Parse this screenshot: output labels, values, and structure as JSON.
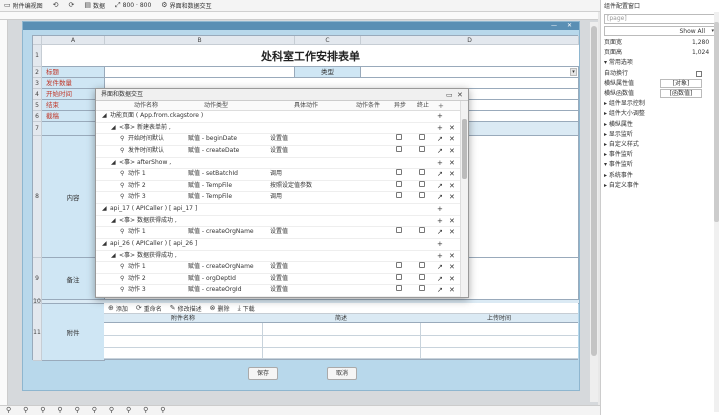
{
  "toolbar": {
    "items": [
      "附件编视图",
      "⟲",
      "⟳",
      "数据",
      "800 · 800",
      "界面和数据交互"
    ]
  },
  "form": {
    "title": "处科室工作安排表单",
    "columns": [
      "A",
      "B",
      "C",
      "D"
    ],
    "rows": [
      "1",
      "2",
      "3",
      "4",
      "5",
      "6",
      "7",
      "8",
      "9",
      "10",
      "11"
    ],
    "labels": {
      "label1": "标题",
      "label2": "发件数量",
      "label3": "开始时间",
      "label4": "结束",
      "label5": "截稿",
      "type": "类型",
      "content": "内容",
      "remark": "备注",
      "attachment": "附件"
    },
    "attachment_toolbar": [
      "添加",
      "重命名",
      "修改描述",
      "删除",
      "下载"
    ],
    "attachment_cols": [
      "附件名称",
      "简述",
      "上传时间"
    ],
    "buttons": {
      "save": "保存",
      "cancel": "取消"
    }
  },
  "dialog": {
    "title": "界面和数据交互",
    "headers": [
      "动作名称",
      "动作类型",
      "具体动作",
      "动作条件",
      "异步",
      "终止"
    ],
    "rows": [
      {
        "indent": 0,
        "name": "功能页面 ( App.from.ckagstore )",
        "type": "",
        "detail": "",
        "checks": false
      },
      {
        "indent": 1,
        "name": "<事> 新建表单前 ,",
        "type": "",
        "detail": "",
        "checks": false
      },
      {
        "indent": 2,
        "name": "开始时间默认",
        "type": "赋值 - beginDate",
        "detail": "设置值",
        "checks": true
      },
      {
        "indent": 2,
        "name": "发件时间默认",
        "type": "赋值 - createDate",
        "detail": "设置值",
        "checks": true
      },
      {
        "indent": 1,
        "name": "<事> afterShow ,",
        "type": "",
        "detail": "",
        "checks": false
      },
      {
        "indent": 2,
        "name": "动作 1",
        "type": "赋值 - setBatchId",
        "detail": "调用",
        "checks": true
      },
      {
        "indent": 2,
        "name": "动作 2",
        "type": "赋值 - TempFile",
        "detail": "按照设定值参数",
        "checks": true
      },
      {
        "indent": 2,
        "name": "动作 3",
        "type": "赋值 - TempFile",
        "detail": "调用",
        "checks": true
      },
      {
        "indent": 0,
        "name": "api_17 ( APICaller ) [ api_17 ]",
        "type": "",
        "detail": "",
        "checks": false
      },
      {
        "indent": 1,
        "name": "<事> 数据获得成功 ,",
        "type": "",
        "detail": "",
        "checks": false
      },
      {
        "indent": 2,
        "name": "动作 1",
        "type": "赋值 - createOrgName",
        "detail": "设置值",
        "checks": true
      },
      {
        "indent": 0,
        "name": "api_26 ( APICaller ) [ api_26 ]",
        "type": "",
        "detail": "",
        "checks": false
      },
      {
        "indent": 1,
        "name": "<事> 数据获得成功 ,",
        "type": "",
        "detail": "",
        "checks": false
      },
      {
        "indent": 2,
        "name": "动作 1",
        "type": "赋值 - createOrgName",
        "detail": "设置值",
        "checks": true
      },
      {
        "indent": 2,
        "name": "动作 2",
        "type": "赋值 - orgDeptId",
        "detail": "设置值",
        "checks": true
      },
      {
        "indent": 2,
        "name": "动作 3",
        "type": "赋值 - createOrgId",
        "detail": "设置值",
        "checks": true
      }
    ]
  },
  "right_panel": {
    "title": "组件配置窗口",
    "search_placeholder": "[page]",
    "show_all": "Show All",
    "items": [
      {
        "label": "页面宽",
        "value": "1,280"
      },
      {
        "label": "页面高",
        "value": "1,024"
      },
      {
        "label": "▾ 常用选项",
        "value": ""
      },
      {
        "label": "自动换行",
        "value": ""
      },
      {
        "label": "横纵属性值",
        "value": "[对象]"
      },
      {
        "label": "横纵函数值",
        "value": "[函数值]"
      },
      {
        "label": "▸ 组件显示控制",
        "value": ""
      },
      {
        "label": "▸ 组件大小调整",
        "value": ""
      },
      {
        "label": "▸ 横纵属性",
        "value": ""
      },
      {
        "label": "▸ 显示监听",
        "value": ""
      },
      {
        "label": "▸ 自定义样式",
        "value": ""
      },
      {
        "label": "▸ 事件监听",
        "value": ""
      },
      {
        "label": "▾ 事件监听",
        "value": ""
      },
      {
        "label": "  ▸ 系统事件",
        "value": ""
      },
      {
        "label": "  ▸ 自定义事件",
        "value": ""
      }
    ]
  },
  "bottom_tools": [
    "⚲",
    "⚲",
    "⚲",
    "⚲",
    "⚲",
    "⚲",
    "⚲",
    "⚲",
    "⚲",
    "⚲"
  ]
}
